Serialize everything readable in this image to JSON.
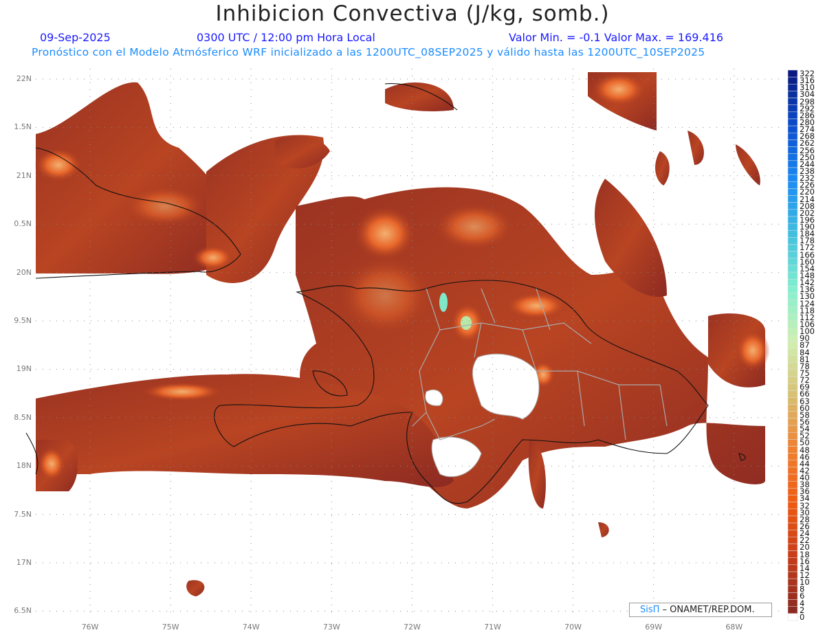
{
  "title": "Inhibicion Convectiva (J/kg, somb.)",
  "header": {
    "date": "09-Sep-2025",
    "time": "0300 UTC / 12:00 pm Hora Local",
    "min_max": "Valor Min. = -0.1  Valor Max. = 169.416",
    "subtitle": "Pronóstico con el Modelo Atmósferico WRF inicializado a las 1200UTC_08SEP2025 y válido hasta las  1200UTC_10SEP2025"
  },
  "lat_labels": [
    "22N",
    "1.5N",
    "21N",
    "0.5N",
    "20N",
    "9.5N",
    "19N",
    "8.5N",
    "18N",
    "7.5N",
    "17N",
    "6.5N"
  ],
  "lon_labels": [
    "76W",
    "75W",
    "74W",
    "73W",
    "72W",
    "71W",
    "70W",
    "69W",
    "68W"
  ],
  "colorbar": {
    "labels": [
      "322",
      "316",
      "310",
      "304",
      "298",
      "292",
      "286",
      "280",
      "274",
      "268",
      "262",
      "256",
      "250",
      "244",
      "238",
      "232",
      "226",
      "220",
      "214",
      "208",
      "202",
      "196",
      "190",
      "184",
      "178",
      "172",
      "166",
      "160",
      "154",
      "148",
      "142",
      "136",
      "130",
      "124",
      "118",
      "112",
      "106",
      "100",
      "90",
      "87",
      "84",
      "81",
      "78",
      "75",
      "72",
      "69",
      "66",
      "63",
      "60",
      "58",
      "56",
      "54",
      "52",
      "50",
      "48",
      "46",
      "44",
      "42",
      "40",
      "38",
      "36",
      "34",
      "32",
      "30",
      "28",
      "26",
      "24",
      "22",
      "20",
      "18",
      "16",
      "14",
      "12",
      "10",
      "8",
      "6",
      "4",
      "2",
      "0"
    ],
    "color_stops": [
      "#0a1a80",
      "#0a4fd0",
      "#1a8cf5",
      "#40c0e0",
      "#80f0d0",
      "#d0f0b0",
      "#d8c070",
      "#f08030",
      "#f05a10",
      "#c83c18",
      "#8c2a22",
      "#ffffff"
    ]
  },
  "credit": {
    "brand": "SisΠ",
    "text": " – ONAMET/REP.DOM."
  }
}
